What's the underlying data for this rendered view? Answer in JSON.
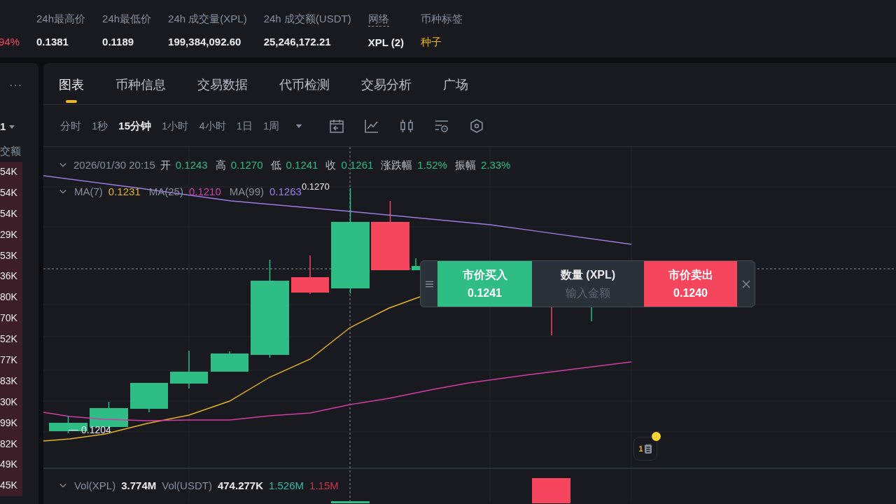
{
  "market_stats": [
    {
      "value": "94%",
      "kind": "change_down"
    },
    {
      "label": "24h最高价",
      "value": "0.1381",
      "kind": "number"
    },
    {
      "label": "24h最低价",
      "value": "0.1189",
      "kind": "number"
    },
    {
      "label": "24h 成交量(XPL)",
      "value": "199,384,092.60",
      "kind": "number"
    },
    {
      "label": "24h 成交额(USDT)",
      "value": "25,246,172.21",
      "kind": "number"
    },
    {
      "label": "网络",
      "value": "XPL (2)",
      "kind": "network"
    },
    {
      "label": "币种标签",
      "value": "种子",
      "kind": "tag"
    }
  ],
  "order_book": {
    "menu": "···",
    "precision": "1",
    "column_heading": "交额",
    "rows": [
      "54K",
      "54K",
      "54K",
      "29K",
      "53K",
      "36K",
      "80K",
      "70K",
      "52K",
      "77K",
      "83K",
      "30K",
      "99K",
      "82K",
      "49K",
      "45K"
    ]
  },
  "tabs": [
    {
      "label": "图表",
      "selected": true
    },
    {
      "label": "币种信息",
      "selected": false
    },
    {
      "label": "交易数据",
      "selected": false
    },
    {
      "label": "代币检测",
      "selected": false
    },
    {
      "label": "交易分析",
      "selected": false
    },
    {
      "label": "广场",
      "selected": false
    }
  ],
  "intervals": [
    {
      "label": "分时",
      "selected": false
    },
    {
      "label": "1秒",
      "selected": false
    },
    {
      "label": "15分钟",
      "selected": true
    },
    {
      "label": "1小时",
      "selected": false
    },
    {
      "label": "4小时",
      "selected": false
    },
    {
      "label": "1日",
      "selected": false
    },
    {
      "label": "1周",
      "selected": false
    }
  ],
  "ohlc": {
    "datetime": "2026/01/30 20:15",
    "fields": [
      {
        "label": "开",
        "value": "0.1243"
      },
      {
        "label": "高",
        "value": "0.1270"
      },
      {
        "label": "低",
        "value": "0.1241"
      },
      {
        "label": "收",
        "value": "0.1261"
      },
      {
        "label": "涨跌幅",
        "value": "1.52%"
      },
      {
        "label": "振幅",
        "value": "2.33%"
      }
    ]
  },
  "moving_averages": [
    {
      "label": "MA(7)",
      "value": "0.1231",
      "color": "#e6b422"
    },
    {
      "label": "MA(25)",
      "value": "0.1210",
      "color": "#d63ca8"
    },
    {
      "label": "MA(99)",
      "value": "0.1263",
      "color": "#9b7ee0"
    }
  ],
  "price_markers": {
    "high": "0.1270",
    "low": "0.1204"
  },
  "volume": {
    "fields": [
      {
        "label": "Vol(XPL)",
        "value": "3.774M"
      },
      {
        "label": "Vol(USDT)",
        "value": "474.277K"
      }
    ],
    "buy": "1.526M",
    "sell": "1.15M"
  },
  "quick_trade": {
    "buy_label": "市价买入",
    "buy_price": "0.1241",
    "quantity_label": "数量 (XPL)",
    "quantity_placeholder": "输入金额",
    "sell_label": "市价卖出",
    "sell_price": "0.1240"
  },
  "notification": {
    "count": "1",
    "unread": true
  }
}
